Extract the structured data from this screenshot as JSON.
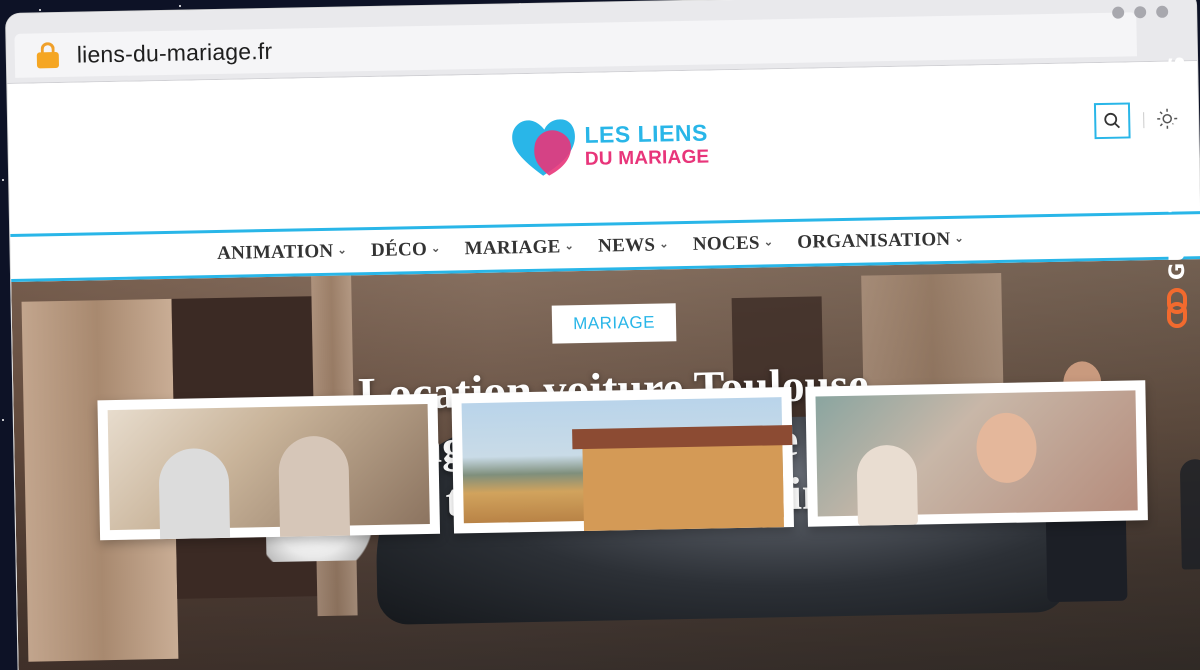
{
  "browser": {
    "url": "liens-du-mariage.fr"
  },
  "site": {
    "logo_line1": "LES LIENS",
    "logo_line2": "DU MARIAGE",
    "colors": {
      "accent": "#29b6e8",
      "pink": "#e8357a"
    }
  },
  "nav": {
    "items": [
      {
        "label": "ANIMATION"
      },
      {
        "label": "DÉCO"
      },
      {
        "label": "MARIAGE"
      },
      {
        "label": "NEWS"
      },
      {
        "label": "NOCES"
      },
      {
        "label": "ORGANISATION"
      }
    ]
  },
  "hero": {
    "category": "MARIAGE",
    "title": "Location voiture Toulouse mariage haut de gamme pour un thème chic et raffiné"
  },
  "watermark": {
    "text": "GUESTPOSTLINKS"
  },
  "icons": {
    "lock": "lock-icon",
    "search": "search-icon",
    "theme": "sun-icon",
    "link": "link-icon"
  }
}
